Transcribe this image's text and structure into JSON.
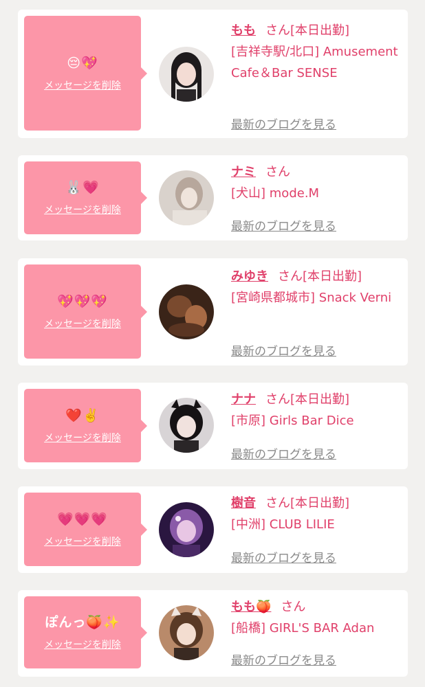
{
  "colors": {
    "background": "#f2f1ef",
    "card": "#ffffff",
    "bubble": "#fc96a8",
    "accent_text": "#e0406a",
    "muted_text": "#8a8a8a"
  },
  "cards": [
    {
      "message": "😔💖",
      "delete_label": "メッセージを削除",
      "name": "もも",
      "san": "さん",
      "status": "[本日出勤]",
      "shop": "[吉祥寺駅/北口] Amusement Cafe＆Bar SENSE",
      "blog_label": "最新のブログを見る"
    },
    {
      "message": "🐰💗",
      "delete_label": "メッセージを削除",
      "name": "ナミ",
      "san": "さん",
      "status": "",
      "shop": "[犬山] mode.M",
      "blog_label": "最新のブログを見る"
    },
    {
      "message": "💖💖💖",
      "delete_label": "メッセージを削除",
      "name": "みゆき",
      "san": "さん",
      "status": "[本日出勤]",
      "shop": "[宮崎県都城市] Snack Verni",
      "blog_label": "最新のブログを見る"
    },
    {
      "message": "❤️✌️",
      "delete_label": "メッセージを削除",
      "name": "ナナ",
      "san": "さん",
      "status": "[本日出勤]",
      "shop": "[市原] Girls Bar Dice",
      "blog_label": "最新のブログを見る"
    },
    {
      "message": "💗💗💗",
      "delete_label": "メッセージを削除",
      "name": "樹音",
      "san": "さん",
      "status": "[本日出勤]",
      "shop": "[中洲] CLUB LILIE",
      "blog_label": "最新のブログを見る"
    },
    {
      "message": "ぽんっ🍑✨",
      "delete_label": "メッセージを削除",
      "name": "もも🍑",
      "san": "さん",
      "status": "",
      "shop": "[船橋] GIRL'S BAR Adan",
      "blog_label": "最新のブログを見る"
    }
  ]
}
